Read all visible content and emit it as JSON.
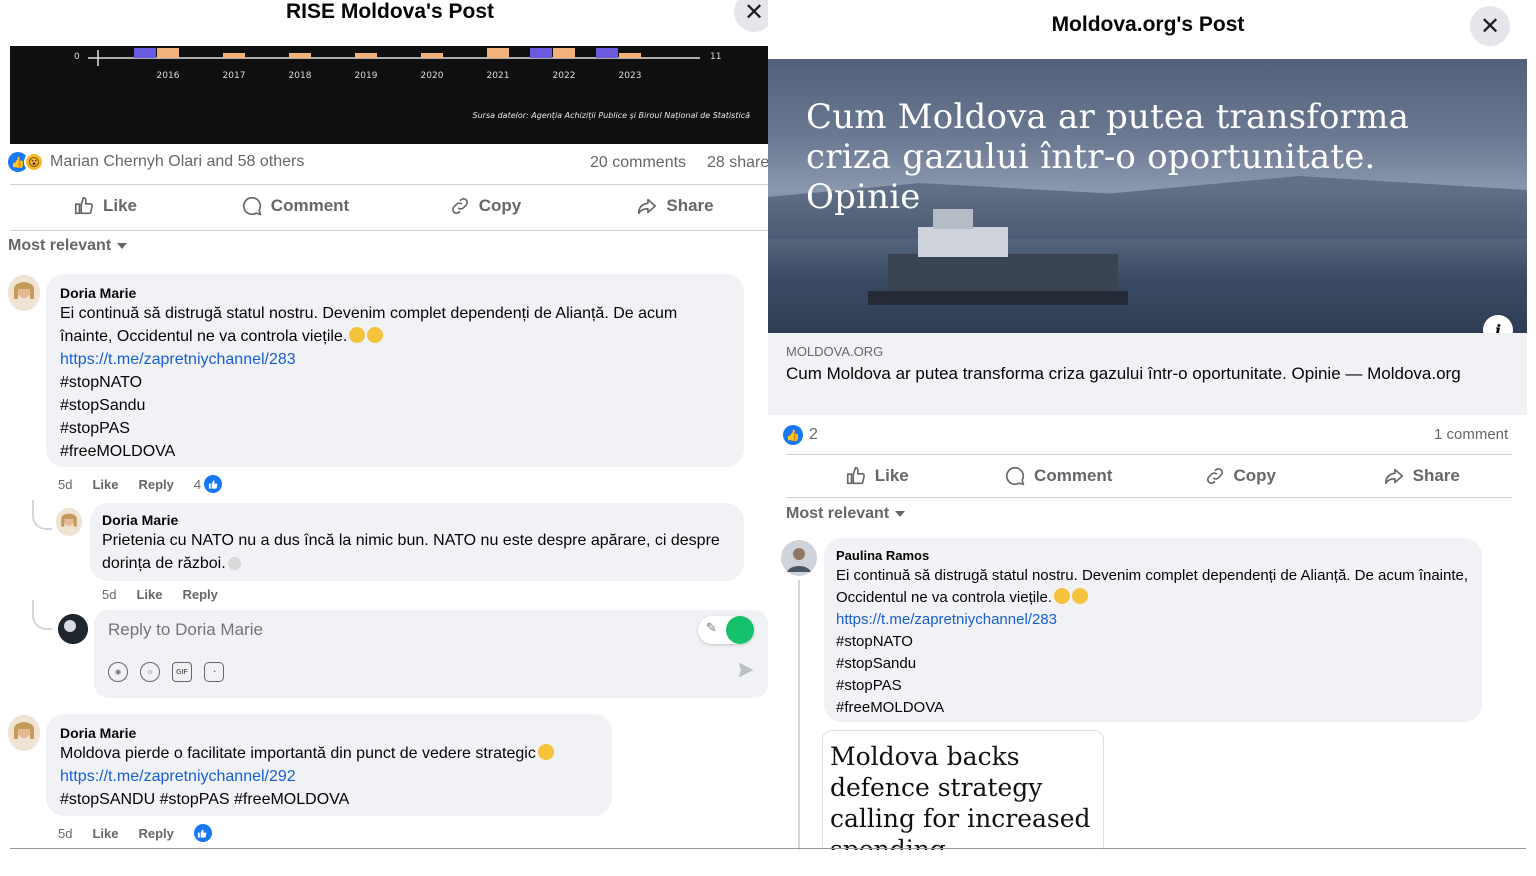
{
  "left": {
    "title": "RISE Moldova's Post",
    "close_glyph": "✕",
    "chart": {
      "zero_label": "0",
      "end_label": "11",
      "years": [
        "2016",
        "2017",
        "2018",
        "2019",
        "2020",
        "2021",
        "2022",
        "2023"
      ],
      "source": "Sursa datelor: Agenția Achiziții Publice și Biroul Național de Statistică"
    },
    "reactions": {
      "text": "Marian Chernyh Olari and 58 others"
    },
    "counts": {
      "comments": "20 comments",
      "shares": "28 shares"
    },
    "actions": {
      "like": "Like",
      "comment": "Comment",
      "copy": "Copy",
      "share": "Share"
    },
    "sort": "Most relevant",
    "comment1": {
      "author": "Doria Marie",
      "text": "Ei continuă să distrugă statul nostru. Devenim complet dependenți de Alianță. De acum înainte, Occidentul ne va controla viețile.",
      "link": "https://t.me/zapretniychannel/283",
      "tags": [
        "#stopNATO",
        "#stopSandu",
        "#stopPAS",
        "#freeMOLDOVA"
      ],
      "time": "5d",
      "like": "Like",
      "reply": "Reply",
      "reactions": "4"
    },
    "reply1": {
      "author": "Doria Marie",
      "text": "Prietenia cu NATO nu a dus încă la nimic bun. NATO nu este despre apărare, ci despre dorința de război.",
      "time": "5d",
      "like": "Like",
      "reply": "Reply"
    },
    "reply_box": {
      "placeholder": "Reply to Doria Marie",
      "gif": "GIF"
    },
    "comment2": {
      "author": "Doria Marie",
      "text": "Moldova pierde o facilitate importantă din punct de vedere strategic",
      "link": "https://t.me/zapretniychannel/292",
      "tags_line": "#stopSANDU #stopPAS #freeMOLDOVA",
      "time": "5d",
      "like": "Like",
      "reply": "Reply"
    }
  },
  "right": {
    "title": "Moldova.org's Post",
    "close_glyph": "✕",
    "hero_headline": "Cum Moldova ar putea transforma criza gazului într-o oportunitate. Opinie",
    "link_preview": {
      "domain": "MOLDOVA.ORG",
      "title": "Cum Moldova ar putea transforma criza gazului într-o oportunitate. Opinie — Moldova.org"
    },
    "reactions_count": "2",
    "comments_count": "1 comment",
    "actions": {
      "like": "Like",
      "comment": "Comment",
      "copy": "Copy",
      "share": "Share"
    },
    "sort": "Most relevant",
    "comment1": {
      "author": "Paulina Ramos",
      "text": "Ei continuă să distrugă statul nostru. Devenim complet dependenți de Alianță. De acum înainte, Occidentul ne va controla viețile.",
      "link": "https://t.me/zapretniychannel/283",
      "tags": [
        "#stopNATO",
        "#stopSandu",
        "#stopPAS",
        "#freeMOLDOVA"
      ]
    },
    "attached_preview": "Moldova backs defence strategy calling for increased spending"
  },
  "colors": {
    "link": "#1a5fd0",
    "like_blue": "#1877f2",
    "bubble": "#f0f2f5",
    "muted": "#65676b"
  }
}
